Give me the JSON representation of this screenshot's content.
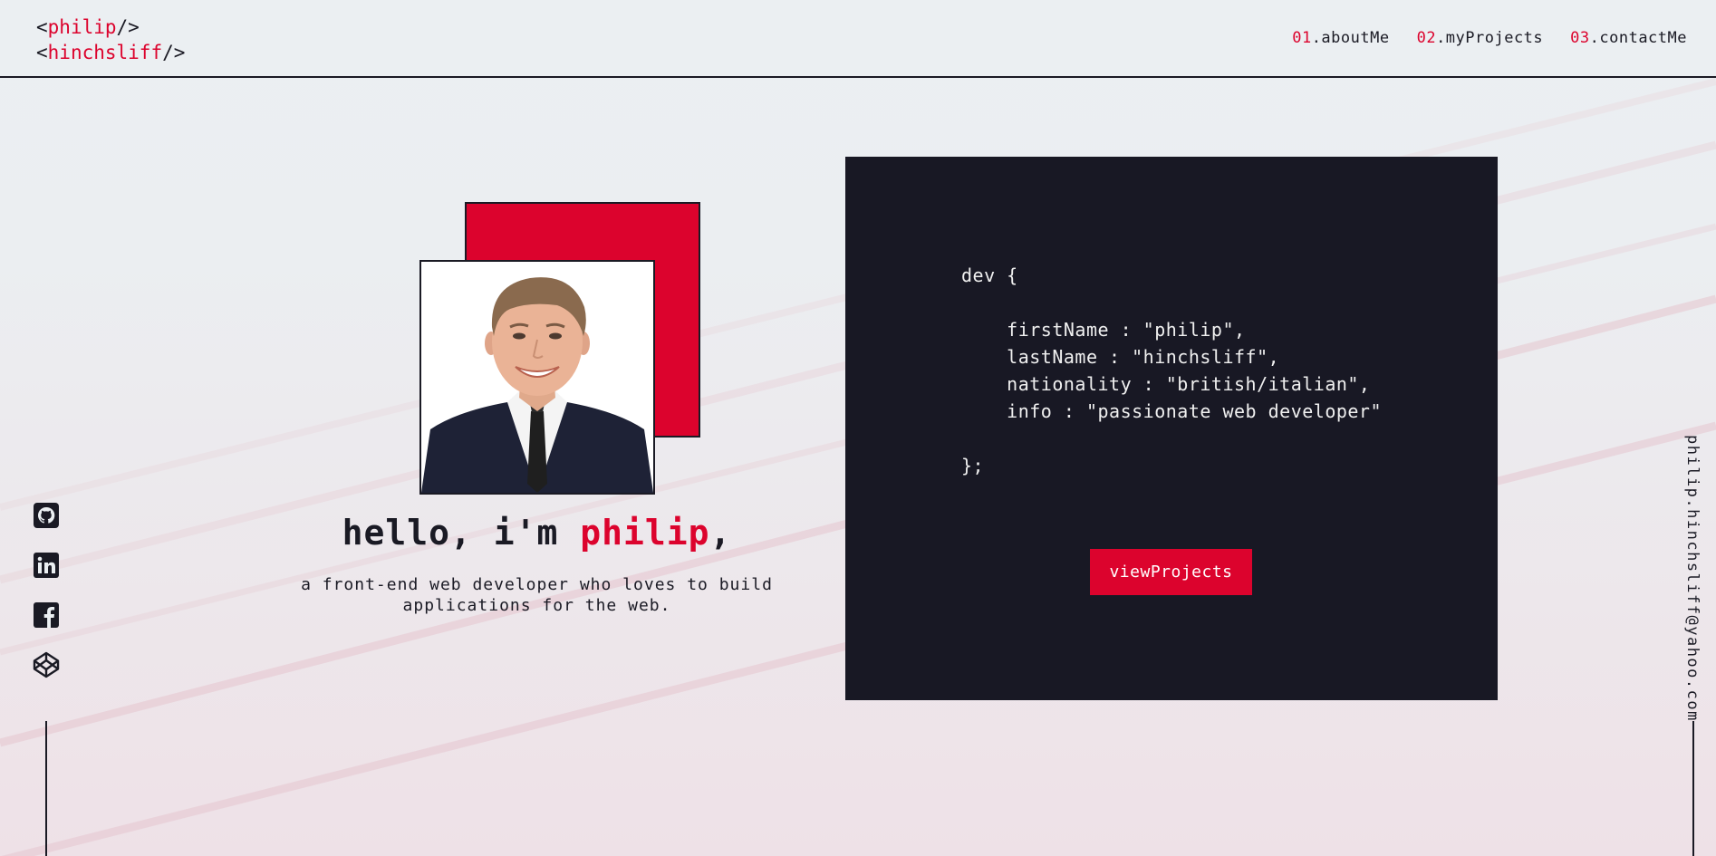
{
  "header": {
    "logo_line1": {
      "open": "<",
      "name": "philip",
      "close": "/>"
    },
    "logo_line2": {
      "open": "<",
      "name": "hinchsliff",
      "close": "/>"
    },
    "nav": [
      {
        "num": "01",
        "label": ".aboutMe"
      },
      {
        "num": "02",
        "label": ".myProjects"
      },
      {
        "num": "03",
        "label": ".contactMe"
      }
    ]
  },
  "social": {
    "icons": [
      "github-icon",
      "linkedin-icon",
      "facebook-icon",
      "codepen-icon"
    ]
  },
  "email": "philip.hinchsliff@yahoo.com",
  "hero": {
    "greeting_prefix": "hello, i'm ",
    "greeting_name": "philip",
    "greeting_suffix": ",",
    "tagline": "a front-end web developer who loves to build applications for the web."
  },
  "code_panel": {
    "code_text": "dev {\n\n    firstName : \"philip\",\n    lastName : \"hinchsliff\",\n    nationality : \"british/italian\",\n    info : \"passionate web developer\"\n\n};",
    "button_label": "viewProjects"
  },
  "colors": {
    "accent": "#dc032d",
    "dark": "#181824",
    "background": "#ebeff2"
  }
}
